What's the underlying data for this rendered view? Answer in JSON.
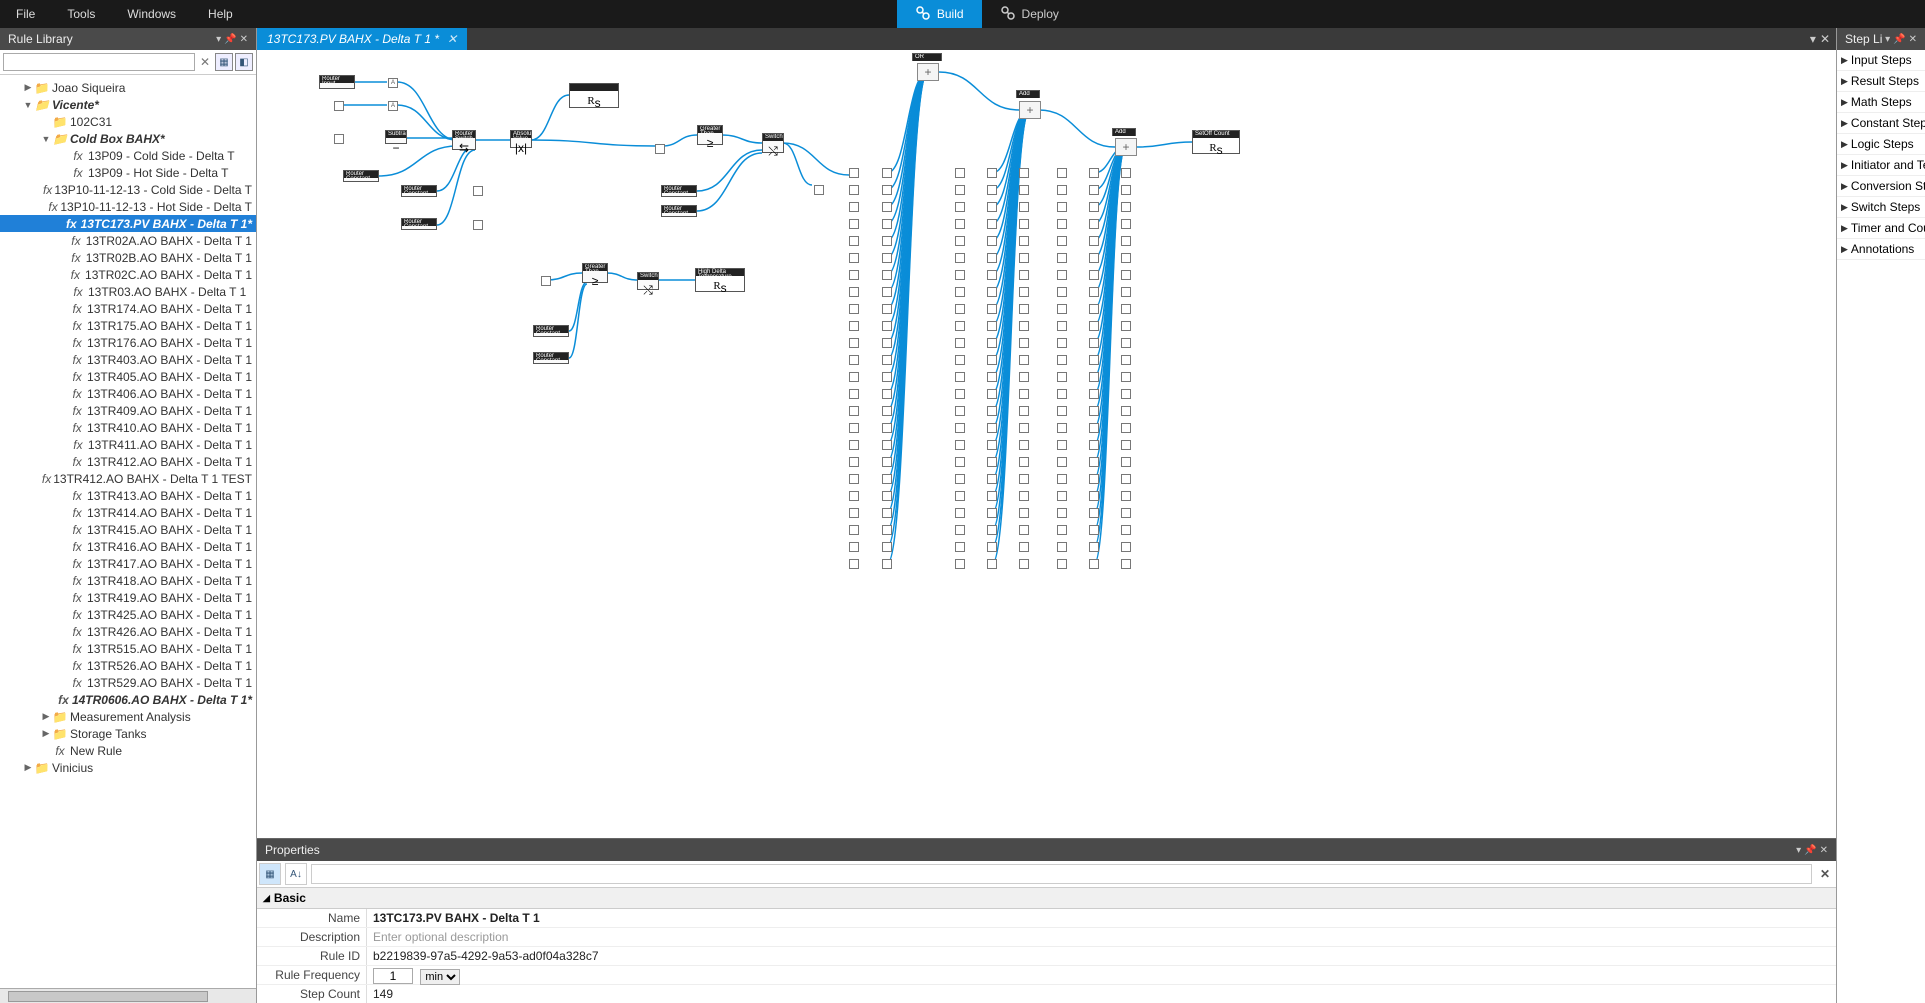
{
  "menubar": {
    "file": "File",
    "tools": "Tools",
    "windows": "Windows",
    "help": "Help",
    "build": "Build",
    "deploy": "Deploy"
  },
  "left_panel": {
    "title": "Rule Library",
    "search_placeholder": "",
    "tree": [
      {
        "level": 0,
        "caret": "▶",
        "icon": "folder",
        "label": "Joao Siqueira",
        "italic": false
      },
      {
        "level": 0,
        "caret": "▼",
        "icon": "folder",
        "label": "Vicente*",
        "italic": true
      },
      {
        "level": 1,
        "caret": "",
        "icon": "folder",
        "label": "102C31",
        "italic": false
      },
      {
        "level": 1,
        "caret": "▼",
        "icon": "folder",
        "label": "Cold Box BAHX*",
        "italic": true
      },
      {
        "level": 2,
        "caret": "",
        "icon": "fx",
        "label": "13P09 - Cold Side - Delta T",
        "italic": false
      },
      {
        "level": 2,
        "caret": "",
        "icon": "fx",
        "label": "13P09 - Hot Side - Delta T",
        "italic": false
      },
      {
        "level": 2,
        "caret": "",
        "icon": "fx",
        "label": "13P10-11-12-13 - Cold Side - Delta T",
        "italic": false
      },
      {
        "level": 2,
        "caret": "",
        "icon": "fx",
        "label": "13P10-11-12-13 - Hot Side - Delta T",
        "italic": false
      },
      {
        "level": 2,
        "caret": "",
        "icon": "fx",
        "label": "13TC173.PV BAHX - Delta T 1*",
        "italic": true,
        "selected": true
      },
      {
        "level": 2,
        "caret": "",
        "icon": "fx",
        "label": "13TR02A.AO BAHX - Delta T 1",
        "italic": false
      },
      {
        "level": 2,
        "caret": "",
        "icon": "fx",
        "label": "13TR02B.AO BAHX - Delta T 1",
        "italic": false
      },
      {
        "level": 2,
        "caret": "",
        "icon": "fx",
        "label": "13TR02C.AO BAHX - Delta T 1",
        "italic": false
      },
      {
        "level": 2,
        "caret": "",
        "icon": "fx",
        "label": "13TR03.AO BAHX - Delta T 1",
        "italic": false
      },
      {
        "level": 2,
        "caret": "",
        "icon": "fx",
        "label": "13TR174.AO BAHX - Delta T 1",
        "italic": false
      },
      {
        "level": 2,
        "caret": "",
        "icon": "fx",
        "label": "13TR175.AO BAHX - Delta T 1",
        "italic": false
      },
      {
        "level": 2,
        "caret": "",
        "icon": "fx",
        "label": "13TR176.AO BAHX - Delta T 1",
        "italic": false
      },
      {
        "level": 2,
        "caret": "",
        "icon": "fx",
        "label": "13TR403.AO BAHX - Delta T 1",
        "italic": false
      },
      {
        "level": 2,
        "caret": "",
        "icon": "fx",
        "label": "13TR405.AO BAHX - Delta T 1",
        "italic": false
      },
      {
        "level": 2,
        "caret": "",
        "icon": "fx",
        "label": "13TR406.AO BAHX - Delta T 1",
        "italic": false
      },
      {
        "level": 2,
        "caret": "",
        "icon": "fx",
        "label": "13TR409.AO BAHX - Delta T 1",
        "italic": false
      },
      {
        "level": 2,
        "caret": "",
        "icon": "fx",
        "label": "13TR410.AO BAHX - Delta T 1",
        "italic": false
      },
      {
        "level": 2,
        "caret": "",
        "icon": "fx",
        "label": "13TR411.AO BAHX - Delta T 1",
        "italic": false
      },
      {
        "level": 2,
        "caret": "",
        "icon": "fx",
        "label": "13TR412.AO BAHX - Delta T 1",
        "italic": false
      },
      {
        "level": 2,
        "caret": "",
        "icon": "fx",
        "label": "13TR412.AO BAHX - Delta T 1 TEST",
        "italic": false
      },
      {
        "level": 2,
        "caret": "",
        "icon": "fx",
        "label": "13TR413.AO BAHX - Delta T 1",
        "italic": false
      },
      {
        "level": 2,
        "caret": "",
        "icon": "fx",
        "label": "13TR414.AO BAHX - Delta T 1",
        "italic": false
      },
      {
        "level": 2,
        "caret": "",
        "icon": "fx",
        "label": "13TR415.AO BAHX - Delta T 1",
        "italic": false
      },
      {
        "level": 2,
        "caret": "",
        "icon": "fx",
        "label": "13TR416.AO BAHX - Delta T 1",
        "italic": false
      },
      {
        "level": 2,
        "caret": "",
        "icon": "fx",
        "label": "13TR417.AO BAHX - Delta T 1",
        "italic": false
      },
      {
        "level": 2,
        "caret": "",
        "icon": "fx",
        "label": "13TR418.AO BAHX - Delta T 1",
        "italic": false
      },
      {
        "level": 2,
        "caret": "",
        "icon": "fx",
        "label": "13TR419.AO BAHX - Delta T 1",
        "italic": false
      },
      {
        "level": 2,
        "caret": "",
        "icon": "fx",
        "label": "13TR425.AO BAHX - Delta T 1",
        "italic": false
      },
      {
        "level": 2,
        "caret": "",
        "icon": "fx",
        "label": "13TR426.AO BAHX - Delta T 1",
        "italic": false
      },
      {
        "level": 2,
        "caret": "",
        "icon": "fx",
        "label": "13TR515.AO BAHX - Delta T 1",
        "italic": false
      },
      {
        "level": 2,
        "caret": "",
        "icon": "fx",
        "label": "13TR526.AO BAHX - Delta T 1",
        "italic": false
      },
      {
        "level": 2,
        "caret": "",
        "icon": "fx",
        "label": "13TR529.AO BAHX - Delta T 1",
        "italic": false
      },
      {
        "level": 2,
        "caret": "",
        "icon": "fx",
        "label": "14TR0606.AO BAHX - Delta T 1*",
        "italic": true
      },
      {
        "level": 1,
        "caret": "▶",
        "icon": "folder",
        "label": "Measurement Analysis",
        "italic": false
      },
      {
        "level": 1,
        "caret": "▶",
        "icon": "folder",
        "label": "Storage Tanks",
        "italic": false
      },
      {
        "level": 1,
        "caret": "",
        "icon": "fx",
        "label": "New Rule",
        "italic": false
      },
      {
        "level": 0,
        "caret": "▶",
        "icon": "folder",
        "label": "Vinicius",
        "italic": false
      }
    ]
  },
  "center": {
    "tab_title": "13TC173.PV BAHX - Delta T 1 *",
    "nodes": {
      "router_input": "Router Input",
      "subtract": "Subtract",
      "router_switch": "Router Switch",
      "abs": "Absolute Value",
      "greater_than": "Greater Than",
      "switch": "Switch",
      "router_constant": "Router Constant",
      "high_delta": "High Delta Temperature",
      "setoff": "SetOff Count",
      "add": "Add",
      "or": "OR",
      "rs": "Rₛ"
    }
  },
  "properties": {
    "title": "Properties",
    "section": "Basic",
    "rows": {
      "name_label": "Name",
      "name_value": "13TC173.PV BAHX - Delta T 1",
      "desc_label": "Description",
      "desc_placeholder": "Enter optional description",
      "ruleid_label": "Rule ID",
      "ruleid_value": "b2219839-97a5-4292-9a53-ad0f04a328c7",
      "freq_label": "Rule Frequency",
      "freq_value": "1",
      "freq_unit": "min",
      "stepcount_label": "Step Count",
      "stepcount_value": "149"
    }
  },
  "right_panel": {
    "title": "Step Li",
    "categories": [
      "Input Steps",
      "Result Steps",
      "Math Steps",
      "Constant Steps",
      "Logic Steps",
      "Initiator and Ter",
      "Conversion Step",
      "Switch Steps",
      "Timer and Cour",
      "Annotations"
    ]
  }
}
